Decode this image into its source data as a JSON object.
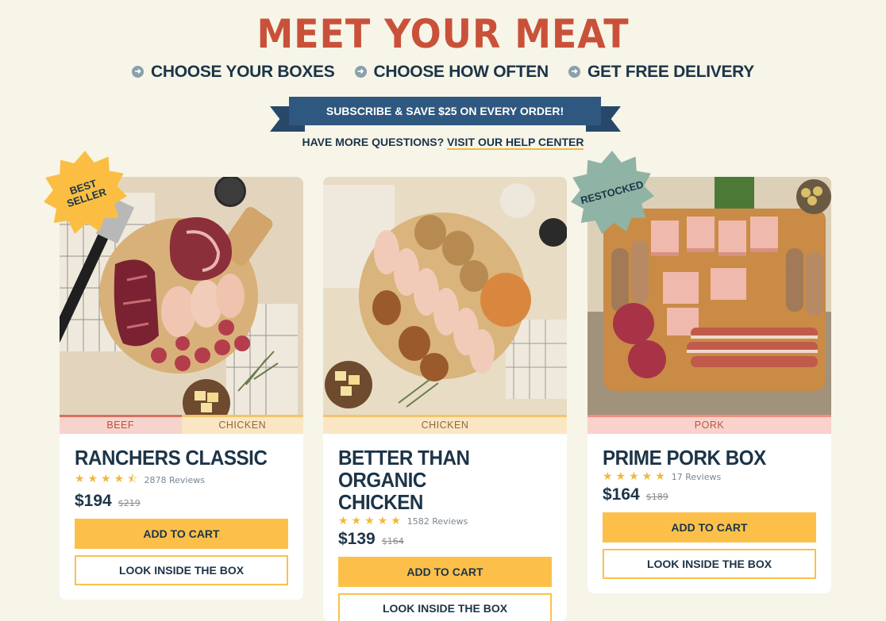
{
  "header": {
    "title": "MEET YOUR MEAT",
    "steps": [
      "CHOOSE YOUR BOXES",
      "CHOOSE HOW OFTEN",
      "GET FREE DELIVERY"
    ],
    "banner": "SUBSCRIBE & SAVE $25 ON EVERY ORDER!",
    "help_prefix": "HAVE MORE QUESTIONS?",
    "help_link": "VISIT OUR HELP CENTER"
  },
  "colors": {
    "title": "#c9513a",
    "navy": "#1c3448",
    "banner": "#2f5880",
    "button": "#fcc04a",
    "background": "#f6f5e8"
  },
  "products": [
    {
      "badge": "BEST SELLER",
      "tags": [
        "BEEF",
        "CHICKEN"
      ],
      "name": "RANCHERS CLASSIC",
      "rating": 4.5,
      "reviews": "2878 Reviews",
      "price": "$194",
      "old_price": "$219",
      "add_label": "ADD TO CART",
      "look_label": "LOOK INSIDE THE BOX"
    },
    {
      "tags": [
        "CHICKEN"
      ],
      "name_line1": "BETTER THAN ORGANIC",
      "name_line2": "CHICKEN",
      "rating": 5,
      "reviews": "1582 Reviews",
      "price": "$139",
      "old_price": "$164",
      "add_label": "ADD TO CART",
      "look_label": "LOOK INSIDE THE BOX"
    },
    {
      "badge": "RESTOCKED",
      "tags": [
        "PORK"
      ],
      "name": "PRIME PORK BOX",
      "rating": 5,
      "reviews": "17 Reviews",
      "price": "$164",
      "old_price": "$189",
      "add_label": "ADD TO CART",
      "look_label": "LOOK INSIDE THE BOX"
    }
  ]
}
